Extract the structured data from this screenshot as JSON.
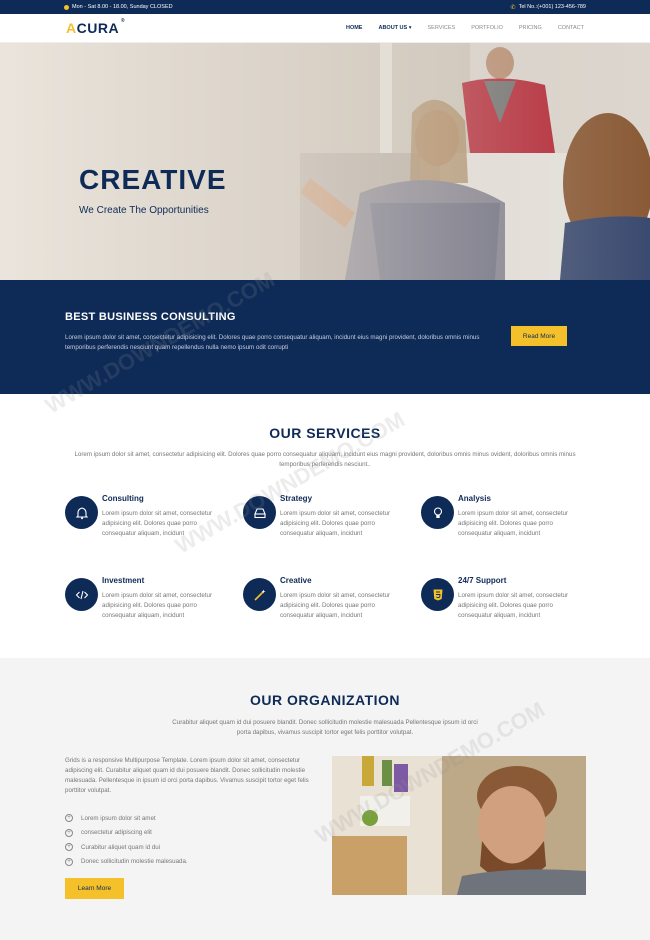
{
  "topbar": {
    "hours": "Mon - Sat 8.00 - 18.00, Sunday CLOSED",
    "phone": "Tel No.:(+001) 123-456-789"
  },
  "nav": {
    "logo": "ACURA",
    "logo_mark": "®",
    "items": [
      {
        "label": "HOME"
      },
      {
        "label": "ABOUT US ▾"
      },
      {
        "label": "SERVICES"
      },
      {
        "label": "PORTFOLIO"
      },
      {
        "label": "PRICING"
      },
      {
        "label": "CONTACT"
      }
    ]
  },
  "hero": {
    "title": "CREATIVE",
    "subtitle": "We Create The Opportunities"
  },
  "consulting": {
    "title": "BEST BUSINESS CONSULTING",
    "text": "Lorem ipsum dolor sit amet, consectetur adipisicing elit. Dolores quae porro consequatur aliquam, incidunt eius magni provident, doloribus omnis minus temporibus perferendis nesciunt quam repellendus nulla nemo ipsum odit corrupti",
    "button": "Read More"
  },
  "services": {
    "title": "OUR SERVICES",
    "desc": "Lorem ipsum dolor sit amet, consectetur adipisicing elit. Dolores quae porro consequatur aliquam, incidunt eius magni provident, doloribus omnis minus ovident, doloribus omnis minus temporibus perferendis nesciunt..",
    "items": [
      {
        "title": "Consulting",
        "text": "Lorem ipsum dolor sit amet, consectetur adipisicing elit. Dolores quae porro consequatur aliquam, incidunt",
        "icon": "bell-icon"
      },
      {
        "title": "Strategy",
        "text": "Lorem ipsum dolor sit amet, consectetur adipisicing elit. Dolores quae porro consequatur aliquam, incidunt",
        "icon": "drive-icon"
      },
      {
        "title": "Analysis",
        "text": "Lorem ipsum dolor sit amet, consectetur adipisicing elit. Dolores quae porro consequatur aliquam, incidunt",
        "icon": "lightbulb-icon"
      },
      {
        "title": "Investment",
        "text": "Lorem ipsum dolor sit amet, consectetur adipisicing elit. Dolores quae porro consequatur aliquam, incidunt",
        "icon": "code-icon"
      },
      {
        "title": "Creative",
        "text": "Lorem ipsum dolor sit amet, consectetur adipisicing elit. Dolores quae porro consequatur aliquam, incidunt",
        "icon": "magic-icon"
      },
      {
        "title": "24/7 Support",
        "text": "Lorem ipsum dolor sit amet, consectetur adipisicing elit. Dolores quae porro consequatur aliquam, incidunt",
        "icon": "html5-icon"
      }
    ]
  },
  "organization": {
    "title": "OUR ORGANIZATION",
    "desc": "Curabitur aliquet quam id dui posuere blandit. Donec sollicitudin molestie malesuada Pellentesque ipsum id orci porta dapibus, vivamus suscipit tortor eget felis porttitor volutpat.",
    "text": "Grids is a responsive Multipurpose Template. Lorem ipsum dolor sit amet, consectetur adipiscing elit. Curabitur aliquet quam id dui posuere blandit. Donec sollicitudin molestie malesuada. Pellentesque in ipsum id orci porta dapibus. Vivamus suscipit tortor eget felis porttitor volutpat.",
    "list": [
      "Lorem ipsum dolor sit amet",
      "consectetur adipiscing elit",
      "Curabitur aliquet quam id dui",
      "Donec sollicitudin molestie malesuada."
    ],
    "button": "Learn More"
  },
  "watermark": "WWW.DOWNDEMO.COM",
  "colors": {
    "navy": "#0e2a57",
    "yellow": "#f5c12a"
  }
}
